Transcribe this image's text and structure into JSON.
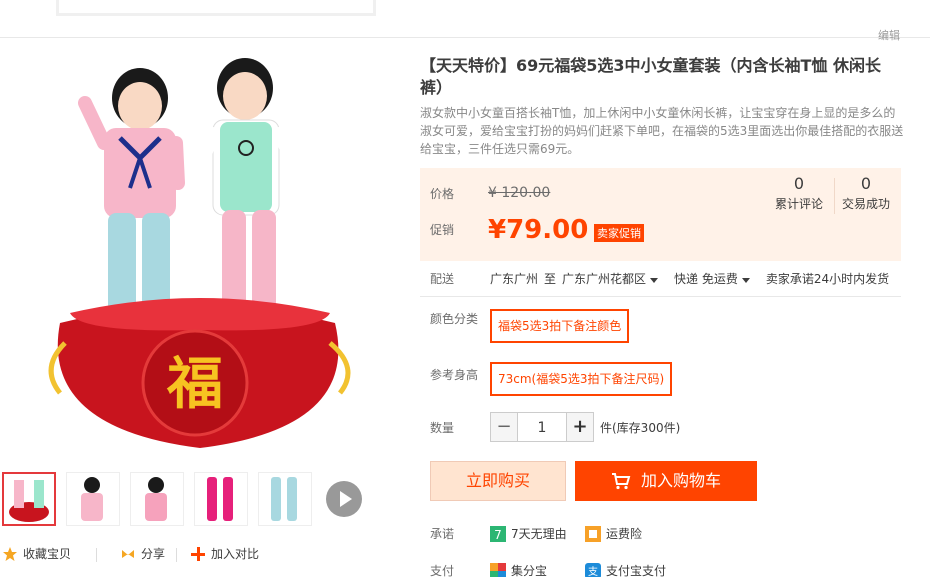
{
  "header": {
    "edit_label": "编辑"
  },
  "product": {
    "title": "【天天特价】69元福袋5选3中小女童套装（内含长袖T恤 休闲长裤）",
    "subtitle": "淑女款中小女童百搭长袖T恤，加上休闲中小女童休闲长裤，让宝宝穿在身上显的是多么的淑女可爱，爱给宝宝打扮的妈妈们赶紧下单吧，在福袋的5选3里面选出你最佳搭配的衣服送给宝宝，三件任选只需69元。",
    "image_badge": "福"
  },
  "price": {
    "label": "价格",
    "original": "¥ 120.00",
    "promo_label": "促销",
    "promo": "¥79.00",
    "promo_tag": "卖家促销",
    "reviews_count": "0",
    "reviews_label": "累计评论",
    "sales_count": "0",
    "sales_label": "交易成功"
  },
  "shipping": {
    "label": "配送",
    "from": "广东广州",
    "to_word": "至",
    "destination": "广东广州花都区",
    "method": "快递 免运费",
    "promise": "卖家承诺24小时内发货"
  },
  "options": {
    "color_label": "颜色分类",
    "color_value": "福袋5选3拍下备注颜色",
    "size_label": "参考身高",
    "size_value": "73cm(福袋5选3拍下备注尺码)"
  },
  "quantity": {
    "label": "数量",
    "value": "1",
    "minus": "−",
    "plus": "+",
    "stock": "件(库存300件)"
  },
  "buttons": {
    "buy_now": "立即购买",
    "add_to_cart": "加入购物车"
  },
  "promises": {
    "label": "承诺",
    "return_label": "7天无理由",
    "insurance_label": "运费险"
  },
  "payment": {
    "label": "支付",
    "method1": "集分宝",
    "method2": "支付宝支付"
  },
  "actions": {
    "favorite": "收藏宝贝",
    "share": "分享",
    "compare": "加入对比"
  },
  "colors": {
    "accent": "#ff4400",
    "price_bg": "#fff2e8"
  }
}
